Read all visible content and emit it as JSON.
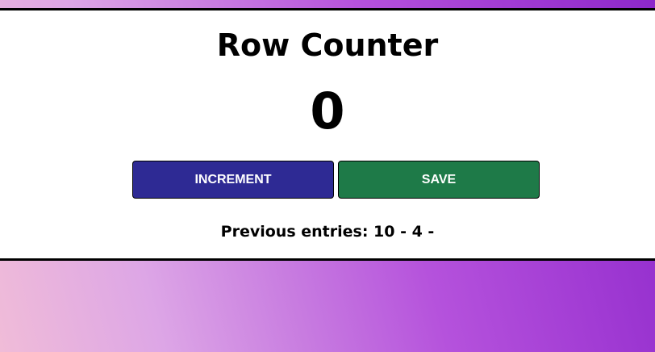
{
  "app": {
    "title": "Row Counter"
  },
  "counter": {
    "value": "0"
  },
  "buttons": {
    "increment_label": "Increment",
    "save_label": "Save"
  },
  "history": {
    "text": "Previous entries: 10 - 4 -"
  },
  "colors": {
    "increment_bg": "#2e2a94",
    "save_bg": "#1e7a48",
    "card_bg": "#ffffff",
    "border": "#000000",
    "background_gradient_start": "#f0bcd8",
    "background_gradient_end": "#8d28ca"
  }
}
